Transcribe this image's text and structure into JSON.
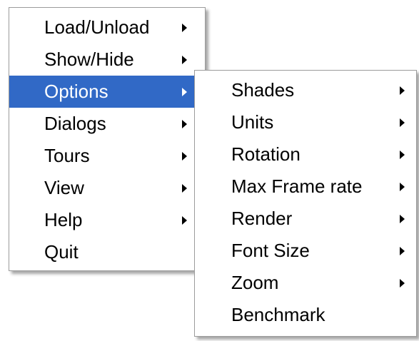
{
  "main_menu": {
    "items": [
      {
        "label": "Load/Unload",
        "has_submenu": true
      },
      {
        "label": "Show/Hide",
        "has_submenu": true
      },
      {
        "label": "Options",
        "has_submenu": true,
        "highlighted": true
      },
      {
        "label": "Dialogs",
        "has_submenu": true
      },
      {
        "label": "Tours",
        "has_submenu": true
      },
      {
        "label": "View",
        "has_submenu": true
      },
      {
        "label": "Help",
        "has_submenu": true
      },
      {
        "label": "Quit",
        "has_submenu": false
      }
    ]
  },
  "options_submenu": {
    "items": [
      {
        "label": "Shades",
        "has_submenu": true
      },
      {
        "label": "Units",
        "has_submenu": true
      },
      {
        "label": "Rotation",
        "has_submenu": true
      },
      {
        "label": "Max Frame rate",
        "has_submenu": true
      },
      {
        "label": "Render",
        "has_submenu": true
      },
      {
        "label": "Font Size",
        "has_submenu": true
      },
      {
        "label": "Zoom",
        "has_submenu": true
      },
      {
        "label": "Benchmark",
        "has_submenu": false
      }
    ]
  },
  "colors": {
    "highlight_background": "#3169c6",
    "highlight_text": "#ffffff",
    "menu_background": "#ffffff",
    "menu_border": "#9c9c9c"
  },
  "icons": {
    "submenu_indicator": "submenu-arrow-icon"
  }
}
